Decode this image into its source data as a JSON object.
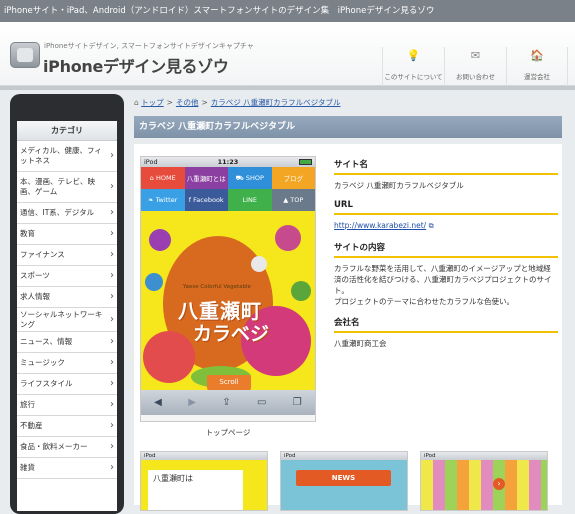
{
  "topbar": {
    "text": "iPhoneサイト・iPad、Android（アンドロイド）スマートフォンサイトのデザイン集　iPhoneデザイン見るゾウ"
  },
  "header": {
    "tagline": "iPhoneサイトデザイン, スマートフォンサイトデザインキャプチャ",
    "title": "iPhoneデザイン見るゾウ",
    "nav": [
      {
        "label": "このサイトについて",
        "icon": "lightbulb-icon",
        "glyph": "💡"
      },
      {
        "label": "お問い合わせ",
        "icon": "envelope-icon",
        "glyph": "✉"
      },
      {
        "label": "運営会社",
        "icon": "house-icon",
        "glyph": "🏠"
      }
    ]
  },
  "sidebar": {
    "heading": "カテゴリ",
    "items": [
      {
        "label": "メディカル、健康、フィットネス"
      },
      {
        "label": "本、漫画、テレビ、映画、ゲーム"
      },
      {
        "label": "通信、IT系、デジタル"
      },
      {
        "label": "教育"
      },
      {
        "label": "ファイナンス"
      },
      {
        "label": "スポーツ"
      },
      {
        "label": "求人情報"
      },
      {
        "label": "ソーシャルネットワーキング"
      },
      {
        "label": "ニュース、情報"
      },
      {
        "label": "ミュージック"
      },
      {
        "label": "ライフスタイル"
      },
      {
        "label": "旅行"
      },
      {
        "label": "不動産"
      },
      {
        "label": "食品・飲料メーカー"
      },
      {
        "label": "雑貨"
      }
    ]
  },
  "breadcrumb": {
    "home": "トップ",
    "mid": "その他",
    "current": "カラベジ 八重瀬町カラフルベジタブル",
    "sep": ">"
  },
  "page": {
    "title": "カラベジ 八重瀬町カラフルベジタブル"
  },
  "screenshot": {
    "status_left": "iPod",
    "time": "11:23",
    "nav": [
      {
        "label": "HOME",
        "color": "#e64b3c"
      },
      {
        "label": "八重瀬町とは",
        "color": "#8b3fa0"
      },
      {
        "label": "SHOP",
        "color": "#2f8fd8"
      },
      {
        "label": "ブログ",
        "color": "#f2a623"
      },
      {
        "label": "Twitter",
        "color": "#3aa0e6"
      },
      {
        "label": "Facebook",
        "color": "#3b5a9a"
      },
      {
        "label": "LINE",
        "color": "#3fb04a"
      },
      {
        "label": "TOP",
        "color": "#6b7a8a"
      }
    ],
    "art_sub": "Yaese Colorful Vegetable",
    "art_title1": "八重瀬町",
    "art_title2": "カラベジ",
    "scroll": "Scroll",
    "caption": "トップページ"
  },
  "info": {
    "site_name_label": "サイト名",
    "site_name": "カラベジ 八重瀬町カラフルベジタブル",
    "url_label": "URL",
    "url": "http://www.karabezi.net/",
    "content_label": "サイトの内容",
    "content": "カラフルな野菜を活用して、八重瀬町のイメージアップと地域経済の活性化を結びつける、八重瀬町カラベジプロジェクトのサイト。\nプロジェクトのテーマに合わせたカラフルな色使い。",
    "company_label": "会社名",
    "company": "八重瀬町商工会"
  },
  "thumbs": {
    "status_left": "iPod",
    "card_text": "八重瀬町は",
    "news": "NEWS",
    "next": "›"
  },
  "colors": {
    "accent_bar": "#7e92a8",
    "underline": "#f2c200",
    "link": "#2a5aa8"
  }
}
